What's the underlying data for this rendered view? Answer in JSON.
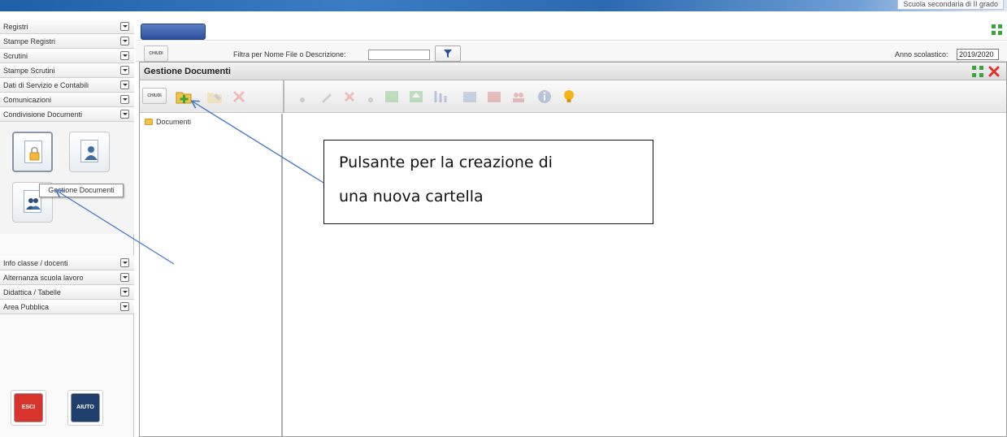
{
  "header": {
    "school_label": "Scuola secondaria di II grado"
  },
  "sidebar": {
    "items": [
      {
        "label": "Registri"
      },
      {
        "label": "Stampe Registri"
      },
      {
        "label": "Scrutini"
      },
      {
        "label": "Stampe Scrutini"
      },
      {
        "label": "Dati di Servizio e Contabili"
      },
      {
        "label": "Comunicazioni"
      },
      {
        "label": "Condivisione Documenti"
      },
      {
        "label": "Info classe / docenti"
      },
      {
        "label": "Alternanza scuola lavoro"
      },
      {
        "label": "Didattica / Tabelle"
      },
      {
        "label": "Area Pubblica"
      }
    ],
    "tooltip": "Gestione Documenti",
    "esci_label": "ESCI",
    "aiuto_label": "AIUTO"
  },
  "toolbar": {
    "chiudi_label": "CHIUDI",
    "filter_label": "Filtra per Nome File o Descrizione:",
    "filter_value": "",
    "year_label": "Anno scolastico:",
    "year_value": "2019/2020"
  },
  "gestione": {
    "title": "Gestione Documenti",
    "chiudi_label": "CHIUDI",
    "tree_root": "Documenti"
  },
  "callout": {
    "line1": "Pulsante per la creazione di",
    "line2": "una nuova cartella"
  },
  "colors": {
    "accent_blue": "#2a4f9c",
    "add_green": "#3aa63a",
    "close_red": "#e0332b",
    "folder_yellow": "#f3c34d",
    "esci_red": "#d9342b",
    "aiuto_navy": "#1f3f6d",
    "arrow_blue": "#4a78c0"
  }
}
